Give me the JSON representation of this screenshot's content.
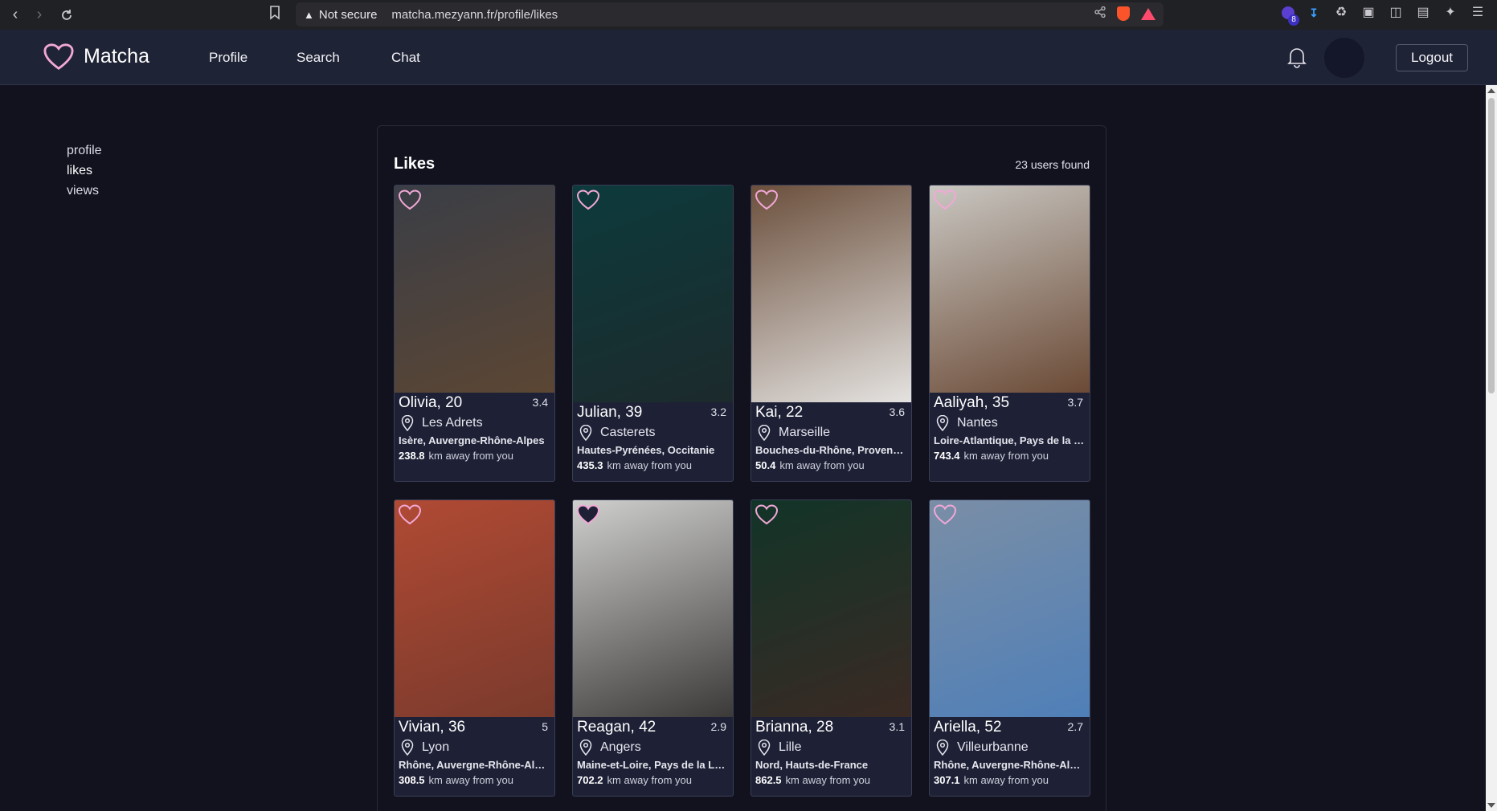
{
  "browser": {
    "security_label": "Not secure",
    "url": "matcha.mezyann.fr/profile/likes",
    "extension_badge": "8"
  },
  "header": {
    "logo_text": "Matcha",
    "nav": [
      "Profile",
      "Search",
      "Chat"
    ],
    "logout_label": "Logout"
  },
  "sidebar": {
    "items": [
      "profile",
      "likes",
      "views"
    ],
    "active": "likes"
  },
  "likes": {
    "title": "Likes",
    "count_text": "23 users found",
    "distance_suffix": "km away from you",
    "users": [
      {
        "name": "Olivia, 20",
        "rating": "3.4",
        "city": "Les Adrets",
        "region": "Isère, Auvergne-Rhône-Alpes",
        "distance": "238.8",
        "liked": false,
        "photo_colors": [
          "#3a3e46",
          "#5c4634"
        ]
      },
      {
        "name": "Julian, 39",
        "rating": "3.2",
        "city": "Casterets",
        "region": "Hautes-Pyrénées, Occitanie",
        "distance": "435.3",
        "liked": false,
        "photo_colors": [
          "#0d3a3c",
          "#1c2a2c"
        ]
      },
      {
        "name": "Kai, 22",
        "rating": "3.6",
        "city": "Marseille",
        "region": "Bouches-du-Rhône, Provence...",
        "distance": "50.4",
        "liked": false,
        "photo_colors": [
          "#6b4f3c",
          "#e4e2e0"
        ]
      },
      {
        "name": "Aaliyah, 35",
        "rating": "3.7",
        "city": "Nantes",
        "region": "Loire-Atlantique, Pays de la L...",
        "distance": "743.4",
        "liked": false,
        "photo_colors": [
          "#c9c7c2",
          "#6b4a36"
        ]
      },
      {
        "name": "Vivian, 36",
        "rating": "5",
        "city": "Lyon",
        "region": "Rhône, Auvergne-Rhône-Alpes",
        "distance": "308.5",
        "liked": false,
        "photo_colors": [
          "#b04a34",
          "#7a3a2c"
        ]
      },
      {
        "name": "Reagan, 42",
        "rating": "2.9",
        "city": "Angers",
        "region": "Maine-et-Loire, Pays de la Loire",
        "distance": "702.2",
        "liked": true,
        "photo_colors": [
          "#cfcfcd",
          "#3c3a38"
        ]
      },
      {
        "name": "Brianna, 28",
        "rating": "3.1",
        "city": "Lille",
        "region": "Nord, Hauts-de-France",
        "distance": "862.5",
        "liked": false,
        "photo_colors": [
          "#123428",
          "#3a2a24"
        ]
      },
      {
        "name": "Ariella, 52",
        "rating": "2.7",
        "city": "Villeurbanne",
        "region": "Rhône, Auvergne-Rhône-Alpes",
        "distance": "307.1",
        "liked": false,
        "photo_colors": [
          "#7a8ea6",
          "#4f7fb8"
        ]
      }
    ]
  },
  "colors": {
    "accent": "#f2a8d6",
    "background": "#11121e",
    "header_bg": "#1f2336",
    "card_bg": "#1e2136"
  }
}
